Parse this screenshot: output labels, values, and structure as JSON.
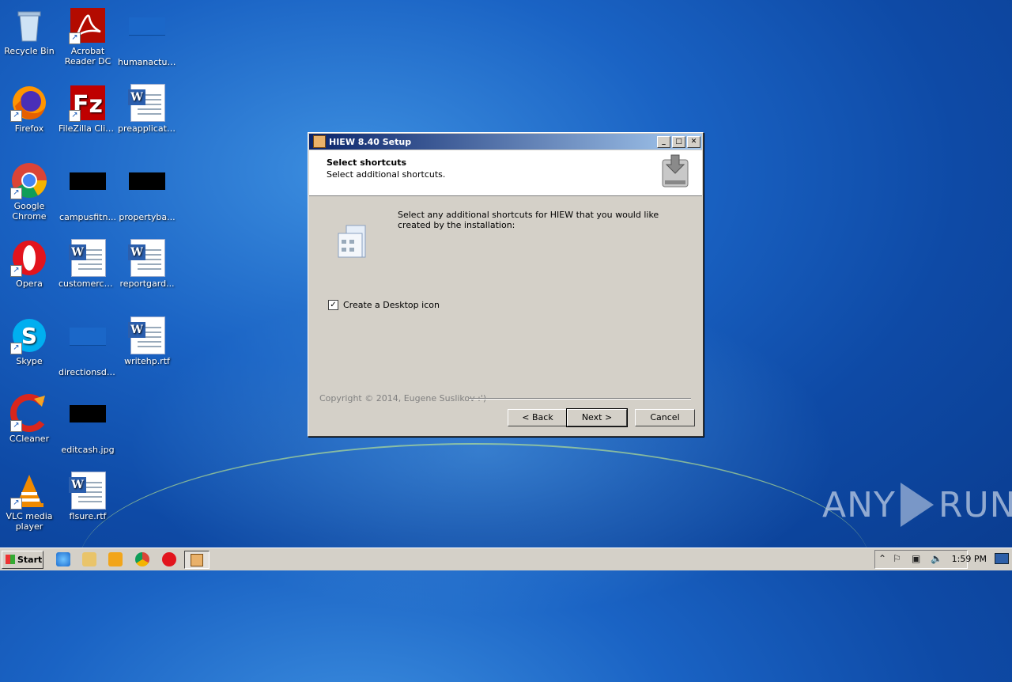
{
  "desktop": {
    "icons": [
      {
        "label": "Recycle Bin",
        "icon": "recycle-bin-icon"
      },
      {
        "label": "Acrobat Reader DC",
        "icon": "acrobat-icon"
      },
      {
        "label": "humanactua...",
        "icon": "file-icon"
      },
      {
        "label": "Firefox",
        "icon": "firefox-icon"
      },
      {
        "label": "FileZilla Client",
        "icon": "filezilla-icon"
      },
      {
        "label": "preapplicati...",
        "icon": "word-doc-icon"
      },
      {
        "label": "Google Chrome",
        "icon": "chrome-icon"
      },
      {
        "label": "campusfitn...",
        "icon": "image-icon"
      },
      {
        "label": "propertyba...",
        "icon": "image-icon"
      },
      {
        "label": "Opera",
        "icon": "opera-icon"
      },
      {
        "label": "customercat...",
        "icon": "word-doc-icon"
      },
      {
        "label": "reportgard...",
        "icon": "word-doc-icon"
      },
      {
        "label": "Skype",
        "icon": "skype-icon"
      },
      {
        "label": "directionsdri...",
        "icon": "file-icon"
      },
      {
        "label": "writehp.rtf",
        "icon": "word-doc-icon"
      },
      {
        "label": "CCleaner",
        "icon": "ccleaner-icon"
      },
      {
        "label": "editcash.jpg",
        "icon": "image-icon"
      },
      {
        "label": "VLC media player",
        "icon": "vlc-icon"
      },
      {
        "label": "flsure.rtf",
        "icon": "word-doc-icon"
      }
    ]
  },
  "dialog": {
    "title": "HIEW 8.40 Setup",
    "header_title": "Select shortcuts",
    "header_subtitle": "Select additional shortcuts.",
    "description": "Select any additional shortcuts for HIEW that you would like created by the installation:",
    "checkbox_label": "Create a Desktop icon",
    "checkbox_checked": true,
    "copyright": "Copyright © 2014, Eugene Suslikov :')",
    "back_label": "< Back",
    "next_label": "Next >",
    "cancel_label": "Cancel",
    "title_buttons": {
      "minimize": "_",
      "maximize": "□",
      "close": "✕"
    }
  },
  "taskbar": {
    "start_label": "Start",
    "clock": "1:59 PM",
    "tray_icons": [
      "chevron-up-icon",
      "flag-icon",
      "network-icon",
      "volume-icon"
    ]
  },
  "watermark": {
    "left": "ANY",
    "right": "RUN"
  },
  "colors": {
    "desktop": "#1a63c4",
    "titlebar_start": "#0a246a",
    "titlebar_end": "#a6caf0"
  }
}
